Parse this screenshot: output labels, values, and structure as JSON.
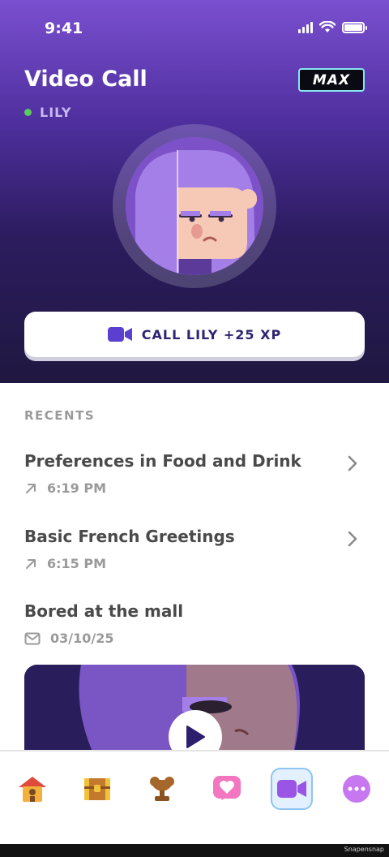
{
  "status_bar": {
    "time": "9:41"
  },
  "header": {
    "title": "Video Call",
    "badge": "MAX",
    "contact_name": "LILY",
    "presence_color": "#58cc5c"
  },
  "call_button": {
    "label": "CALL LILY +25 XP",
    "icon": "video-camera-icon"
  },
  "recents": {
    "heading": "RECENTS",
    "items": [
      {
        "title": "Preferences in Food and Drink",
        "meta": "6:19 PM",
        "icon": "outgoing-arrow-icon",
        "has_chevron": true
      },
      {
        "title": "Basic French Greetings",
        "meta": "6:15 PM",
        "icon": "outgoing-arrow-icon",
        "has_chevron": true
      },
      {
        "title": "Bored at the mall",
        "meta": "03/10/25",
        "icon": "envelope-icon",
        "has_chevron": false
      }
    ]
  },
  "video_card": {
    "icon": "play-icon"
  },
  "tabbar": {
    "tabs": [
      {
        "name": "home",
        "icon": "house-icon",
        "active": false
      },
      {
        "name": "quests",
        "icon": "treasure-chest-icon",
        "active": false
      },
      {
        "name": "leagues",
        "icon": "trophy-icon",
        "active": false
      },
      {
        "name": "health",
        "icon": "heart-icon",
        "active": false
      },
      {
        "name": "video-call",
        "icon": "video-camera-icon",
        "active": true
      },
      {
        "name": "more",
        "icon": "more-dots-icon",
        "active": false
      }
    ]
  },
  "footer": {
    "watermark": "Snapensnap"
  },
  "colors": {
    "accent": "#7a4fd0",
    "button_text": "#2e2470",
    "active_tab_bg": "#e3f0ff",
    "badge_border": "#88e6f2"
  }
}
